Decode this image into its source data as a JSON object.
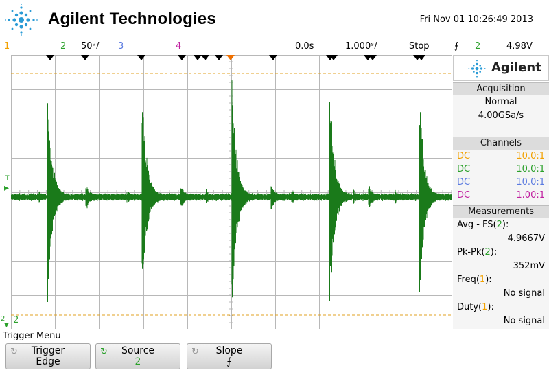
{
  "header": {
    "brand": "Agilent Technologies",
    "datetime": "Fri Nov 01 10:26:49 2013"
  },
  "status": {
    "ch1_label": "1",
    "ch2_label": "2",
    "ch2_scale": "50ᵛ/",
    "ch3_label": "3",
    "ch4_label": "4",
    "time_offset": "0.0s",
    "time_scale": "1.000ˢ/",
    "run_state": "Stop",
    "trigger_slope_glyph": "⨍",
    "trigger_source": "2",
    "trigger_level": "4.98V"
  },
  "screen": {
    "trigger_marker": "T",
    "ground_marker": "2",
    "channel_marker": "2"
  },
  "sidebar": {
    "logo_text": "Agilent",
    "acquisition": {
      "title": "Acquisition",
      "mode": "Normal",
      "rate": "4.00GSa/s"
    },
    "channels": {
      "title": "Channels",
      "rows": [
        {
          "coupling": "DC",
          "probe": "10.0:1",
          "color": "#f2a100"
        },
        {
          "coupling": "DC",
          "probe": "10.0:1",
          "color": "#2aa02a"
        },
        {
          "coupling": "DC",
          "probe": "10.0:1",
          "color": "#5b7be0"
        },
        {
          "coupling": "DC",
          "probe": "1.00:1",
          "color": "#c020a0"
        }
      ]
    },
    "measurements": {
      "title": "Measurements",
      "items": [
        {
          "name": "Avg - FS",
          "src": "2",
          "value": "4.9667V"
        },
        {
          "name": "Pk-Pk",
          "src": "2",
          "value": "352mV"
        },
        {
          "name": "Freq",
          "src": "1",
          "value": "No signal"
        },
        {
          "name": "Duty",
          "src": "1",
          "value": "No signal"
        }
      ]
    }
  },
  "softkeys": {
    "menu_title": "Trigger Menu",
    "trigger": {
      "label": "Trigger",
      "value": "Edge"
    },
    "source": {
      "label": "Source",
      "value": "2"
    },
    "slope": {
      "label": "Slope",
      "value": "⨍"
    }
  },
  "colors": {
    "trace": "#1a7a1a",
    "cursor": "#e0a020",
    "grid": "#b8b8b8",
    "trigger_marker": "#f07000"
  }
}
